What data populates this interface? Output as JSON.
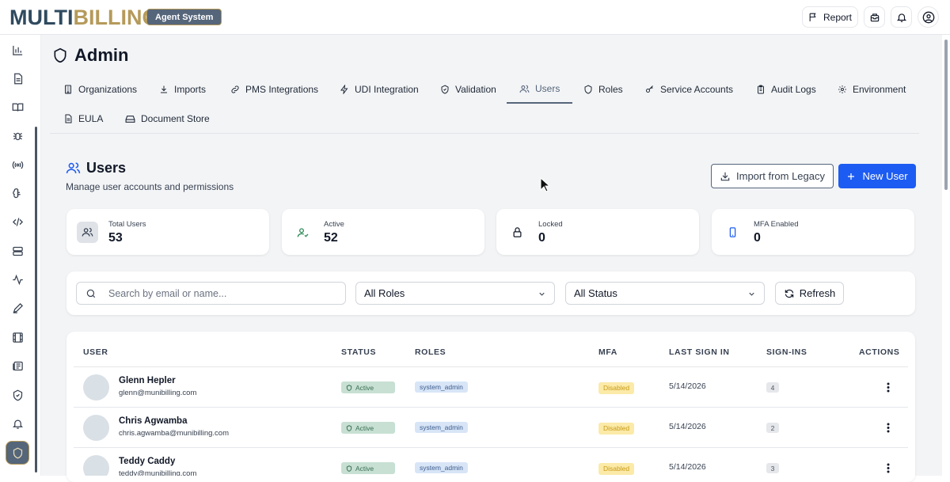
{
  "topbar": {
    "logo_part1": "MULTI",
    "logo_part2": "BILLING",
    "badge": "Agent System",
    "report_label": "Report",
    "icons": [
      "flag-icon",
      "inbox-icon",
      "bell-icon",
      "user-circle-icon"
    ]
  },
  "sidebar": {
    "items": [
      "bar-chart-icon",
      "document-icon",
      "book-icon",
      "bug-icon",
      "radio-icon",
      "brain-icon",
      "code-icon",
      "server-icon",
      "activity-icon",
      "pen-icon",
      "film-icon",
      "newspaper-icon",
      "shield-check-icon",
      "bell-icon"
    ],
    "active": "shield-icon"
  },
  "page": {
    "title": "Admin",
    "tabs": [
      {
        "label": "Organizations",
        "icon": "building-icon"
      },
      {
        "label": "Imports",
        "icon": "download-icon"
      },
      {
        "label": "PMS Integrations",
        "icon": "link-icon"
      },
      {
        "label": "UDI Integration",
        "icon": "zap-icon"
      },
      {
        "label": "Validation",
        "icon": "shield-check-icon"
      },
      {
        "label": "Users",
        "icon": "users-icon",
        "active": true
      },
      {
        "label": "Roles",
        "icon": "shield-icon"
      },
      {
        "label": "Service Accounts",
        "icon": "key-icon"
      },
      {
        "label": "Audit Logs",
        "icon": "clipboard-icon"
      },
      {
        "label": "Environment",
        "icon": "gear-icon"
      },
      {
        "label": "EULA",
        "icon": "file-text-icon"
      },
      {
        "label": "Document Store",
        "icon": "hard-drive-icon"
      }
    ]
  },
  "users": {
    "title": "Users",
    "subtitle": "Manage user accounts and permissions",
    "import_label": "Import from Legacy",
    "new_user_label": "New User",
    "stats": [
      {
        "label": "Total Users",
        "value": "53",
        "icon": "users-icon"
      },
      {
        "label": "Active",
        "value": "52",
        "icon": "user-check-icon",
        "color": "#2e8b57"
      },
      {
        "label": "Locked",
        "value": "0",
        "icon": "lock-icon"
      },
      {
        "label": "MFA Enabled",
        "value": "0",
        "icon": "smartphone-icon",
        "color": "#1d5cf2"
      }
    ],
    "filters": {
      "search_placeholder": "Search by email or name...",
      "role_value": "All Roles",
      "status_value": "All Status",
      "refresh_label": "Refresh"
    },
    "table": {
      "columns": [
        "USER",
        "STATUS",
        "ROLES",
        "MFA",
        "LAST SIGN IN",
        "SIGN-INS",
        "ACTIONS"
      ],
      "rows": [
        {
          "name": "Glenn Hepler",
          "email": "glenn@munibilling.com",
          "status": "Active",
          "role": "system_admin",
          "mfa": "Disabled",
          "last_sign_in": "5/14/2026",
          "sign_ins": "4"
        },
        {
          "name": "Chris Agwamba",
          "email": "chris.agwamba@munibilling.com",
          "status": "Active",
          "role": "system_admin",
          "mfa": "Disabled",
          "last_sign_in": "5/14/2026",
          "sign_ins": "2"
        },
        {
          "name": "Teddy Caddy",
          "email": "teddy@munibilling.com",
          "status": "Active",
          "role": "system_admin",
          "mfa": "Disabled",
          "last_sign_in": "5/14/2026",
          "sign_ins": "3"
        }
      ]
    }
  },
  "colors": {
    "primary": "#1d5cf2",
    "brand_dark": "#2f4a5f",
    "brand_gold": "#b59a5a",
    "active_badge_bg": "#c7e0d3",
    "role_badge_bg": "#d8e5f7",
    "mfa_badge_bg": "#fbeaa8"
  }
}
